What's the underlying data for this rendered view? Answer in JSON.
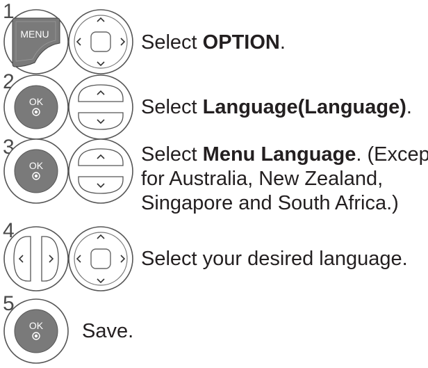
{
  "steps": [
    {
      "number": "1",
      "buttons": [
        "menu-button-icon",
        "four-way-navigation-icon"
      ],
      "menu_label": "MENU",
      "text_prefix": "Select ",
      "text_bold": "OPTION",
      "text_suffix": "."
    },
    {
      "number": "2",
      "buttons": [
        "ok-button-icon",
        "up-down-navigation-icon"
      ],
      "ok_label": "OK",
      "text_prefix": "Select ",
      "text_bold": "Language(Language)",
      "text_suffix": "."
    },
    {
      "number": "3",
      "buttons": [
        "ok-button-icon",
        "up-down-navigation-icon"
      ],
      "ok_label": "OK",
      "text_prefix": "Select ",
      "text_bold": "Menu Language",
      "text_suffix": ". (Except",
      "line2": "for Australia, New Zealand,",
      "line3": "Singapore and South Africa.)"
    },
    {
      "number": "4",
      "buttons": [
        "left-right-navigation-icon",
        "four-way-navigation-icon"
      ],
      "text_prefix": "Select your desired language.",
      "text_bold": "",
      "text_suffix": ""
    },
    {
      "number": "5",
      "buttons": [
        "ok-button-icon"
      ],
      "ok_label": "OK",
      "text_prefix": "Save.",
      "text_bold": "",
      "text_suffix": ""
    }
  ],
  "colors": {
    "text": "#231f20",
    "button_face": "#7a7a7a",
    "outline": "#555555"
  }
}
